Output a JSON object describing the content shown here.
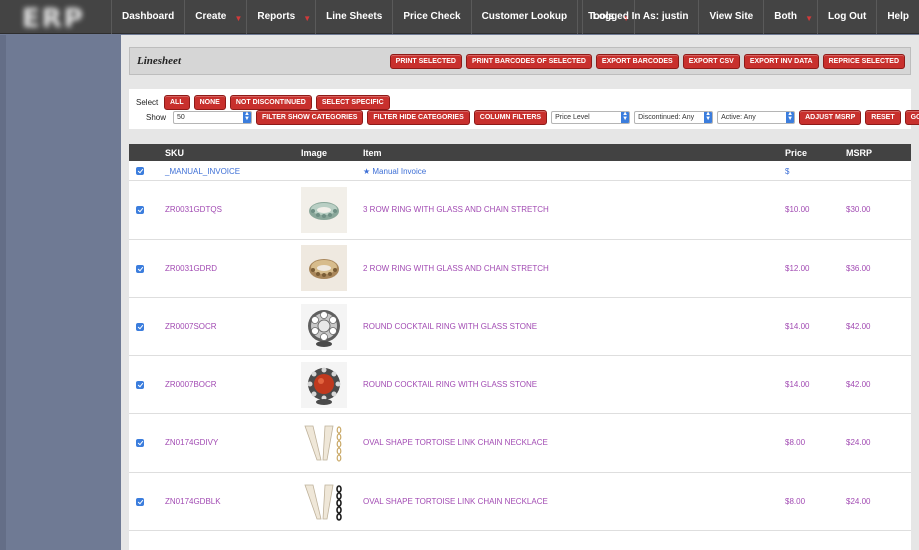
{
  "nav": {
    "left": [
      {
        "label": "Dashboard",
        "dropdown": false
      },
      {
        "label": "Create",
        "dropdown": true
      },
      {
        "label": "Reports",
        "dropdown": true
      },
      {
        "label": "Line Sheets",
        "dropdown": false
      },
      {
        "label": "Price Check",
        "dropdown": false
      },
      {
        "label": "Customer Lookup",
        "dropdown": false
      },
      {
        "label": "Tools",
        "dropdown": true
      }
    ],
    "right": [
      {
        "label": "Logged In As: justin",
        "dropdown": false
      },
      {
        "label": "View Site",
        "dropdown": false
      },
      {
        "label": "Both",
        "dropdown": true
      },
      {
        "label": "Log Out",
        "dropdown": false
      },
      {
        "label": "Help",
        "dropdown": false
      }
    ]
  },
  "page": {
    "title": "Linesheet",
    "actions": [
      "PRINT SELECTED",
      "PRINT BARCODES OF SELECTED",
      "EXPORT BARCODES",
      "EXPORT CSV",
      "EXPORT INV DATA",
      "REPRICE SELECTED"
    ]
  },
  "filters": {
    "select_label": "Select",
    "select_buttons": [
      "ALL",
      "NONE",
      "NOT DISCONTINUED",
      "SELECT SPECIFIC"
    ],
    "show_label": "Show",
    "show_value": "50",
    "filter_buttons": [
      "FILTER SHOW CATEGORIES",
      "FILTER HIDE CATEGORIES",
      "COLUMN FILTERS"
    ],
    "price_level": "Price Level",
    "discontinued": "Discontinued: Any",
    "active": "Active: Any",
    "adjust_msrp": "ADJUST MSRP",
    "reset": "RESET",
    "go": "GO"
  },
  "table": {
    "headers": {
      "sku": "SKU",
      "image": "Image",
      "item": "Item",
      "price": "Price",
      "msrp": "MSRP"
    },
    "rows": [
      {
        "sku": "_MANUAL_INVOICE",
        "item": "★ Manual Invoice",
        "price": "$",
        "msrp": "",
        "image": "",
        "checked": true
      },
      {
        "sku": "ZR0031GDTQS",
        "item": "3 ROW RING WITH GLASS AND CHAIN STRETCH",
        "price": "$10.00",
        "msrp": "$30.00",
        "image": "ring-turquoise",
        "checked": true
      },
      {
        "sku": "ZR0031GDRD",
        "item": "2 ROW RING WITH GLASS AND CHAIN STRETCH",
        "price": "$12.00",
        "msrp": "$36.00",
        "image": "ring-gold",
        "checked": true
      },
      {
        "sku": "ZR0007SOCR",
        "item": "ROUND COCKTAIL RING WITH GLASS STONE",
        "price": "$14.00",
        "msrp": "$42.00",
        "image": "ring-crystal",
        "checked": true
      },
      {
        "sku": "ZR0007BOCR",
        "item": "ROUND COCKTAIL RING WITH GLASS STONE",
        "price": "$14.00",
        "msrp": "$42.00",
        "image": "ring-red",
        "checked": true
      },
      {
        "sku": "ZN0174GDIVY",
        "item": "OVAL SHAPE TORTOISE LINK CHAIN NECKLACE",
        "price": "$8.00",
        "msrp": "$24.00",
        "image": "necklace-ivory",
        "checked": true
      },
      {
        "sku": "ZN0174GDBLK",
        "item": "OVAL SHAPE TORTOISE LINK CHAIN NECKLACE",
        "price": "$8.00",
        "msrp": "$24.00",
        "image": "necklace-black",
        "checked": true
      }
    ]
  }
}
